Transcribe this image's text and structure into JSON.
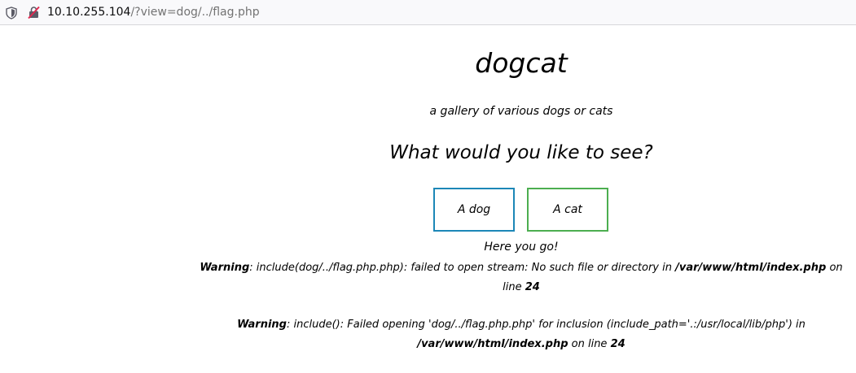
{
  "browser": {
    "url_host": "10.10.255.104",
    "url_path": "/?view=dog/../flag.php",
    "icons": [
      "shield-icon",
      "insecure-connection-icon"
    ]
  },
  "page": {
    "title": "dogcat",
    "tagline": "a gallery of various dogs or cats",
    "question": "What would you like to see?",
    "buttons": {
      "dog": "A dog",
      "cat": "A cat"
    },
    "colors": {
      "dog_border": "#1c87b7",
      "cat_border": "#4cae50"
    },
    "result": "Here you go!",
    "warning1": {
      "label": "Warning",
      "text": ": include(dog/../flag.php.php): failed to open stream: No such file or directory in ",
      "path": "/var/www/html/index.php",
      "on_line": " on line ",
      "line": "24"
    },
    "warning2": {
      "label": "Warning",
      "text": ": include(): Failed opening 'dog/../flag.php.php' for inclusion (include_path='.:/usr/local/lib/php') in ",
      "path": "/var/www/html/index.php",
      "on_line": " on line ",
      "line": "24"
    }
  }
}
